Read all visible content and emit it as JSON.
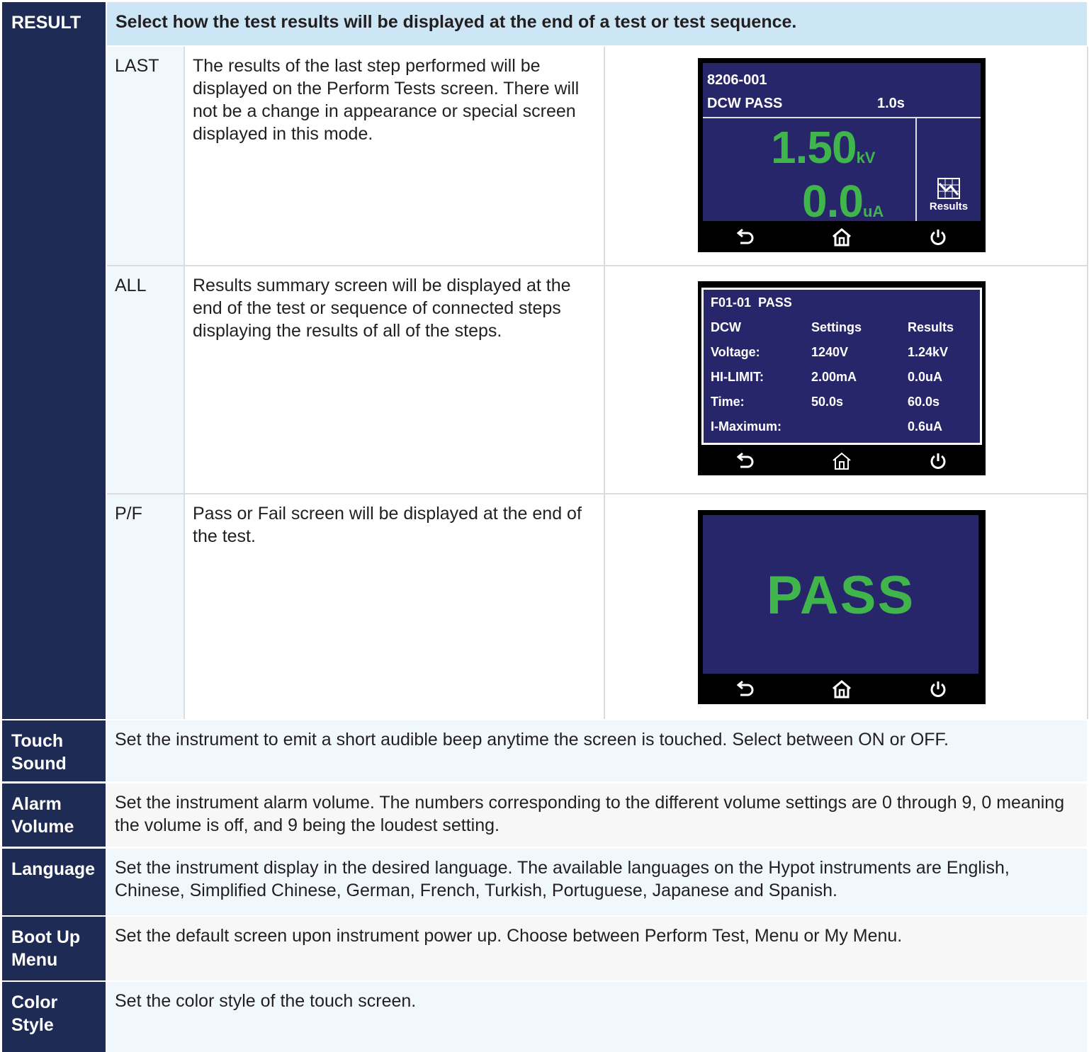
{
  "result": {
    "label": "RESULT",
    "header": "Select how the test results will be displayed at the end of a test or test sequence.",
    "options": [
      {
        "code": "LAST",
        "description": "The results of the last step performed will be displayed on the Perform Tests screen. There will not be a change in appearance or special screen displayed in this mode."
      },
      {
        "code": "ALL",
        "description": "Results summary screen will be displayed at the end of the test or sequence of connected steps displaying the results of all of the steps."
      },
      {
        "code": "P/F",
        "description": "Pass or Fail screen will be displayed at the end of the test."
      }
    ]
  },
  "screen_last": {
    "file": "8206-001",
    "test": "DCW PASS",
    "time": "1.0s",
    "voltage": "1.50",
    "voltage_unit": "kV",
    "current": "0.0",
    "current_unit": "uA",
    "results_button": "Results"
  },
  "screen_all": {
    "title": "F01-01  PASS",
    "columns": [
      "DCW",
      "Settings",
      "Results"
    ],
    "rows": [
      [
        "Voltage:",
        "1240V",
        "1.24kV"
      ],
      [
        "HI-LIMIT:",
        "2.00mA",
        "0.0uA"
      ],
      [
        "Time:",
        "50.0s",
        "60.0s"
      ],
      [
        "I-Maximum:",
        "",
        "0.6uA"
      ]
    ]
  },
  "screen_pf": {
    "status": "PASS"
  },
  "settings": [
    {
      "label_line1": "Touch",
      "label_line2": "Sound",
      "description": "Set the instrument to emit a short audible beep anytime the screen is touched. Select between ON or OFF."
    },
    {
      "label_line1": "Alarm",
      "label_line2": "Volume",
      "description": "Set the instrument alarm volume. The numbers corresponding to the different volume settings are 0 through 9, 0 meaning the volume is off, and 9 being the loudest setting."
    },
    {
      "label_line1": "Language",
      "label_line2": "",
      "description": "Set the instrument display in the desired language. The available languages on the Hypot instruments are English, Chinese, Simplified Chinese, German, French, Turkish, Portuguese, Japanese and Spanish."
    },
    {
      "label_line1": "Boot Up",
      "label_line2": "Menu",
      "description": "Set the default screen upon instrument power up. Choose between Perform Test, Menu or My Menu."
    },
    {
      "label_line1": "Color",
      "label_line2": "Style",
      "description": "Set the color style of the touch screen."
    }
  ],
  "colors": {
    "label_bg": "#1e2b55",
    "header_bg": "#cde6f6",
    "screen_bg": "#27266a",
    "pass_green": "#3fb54c"
  }
}
